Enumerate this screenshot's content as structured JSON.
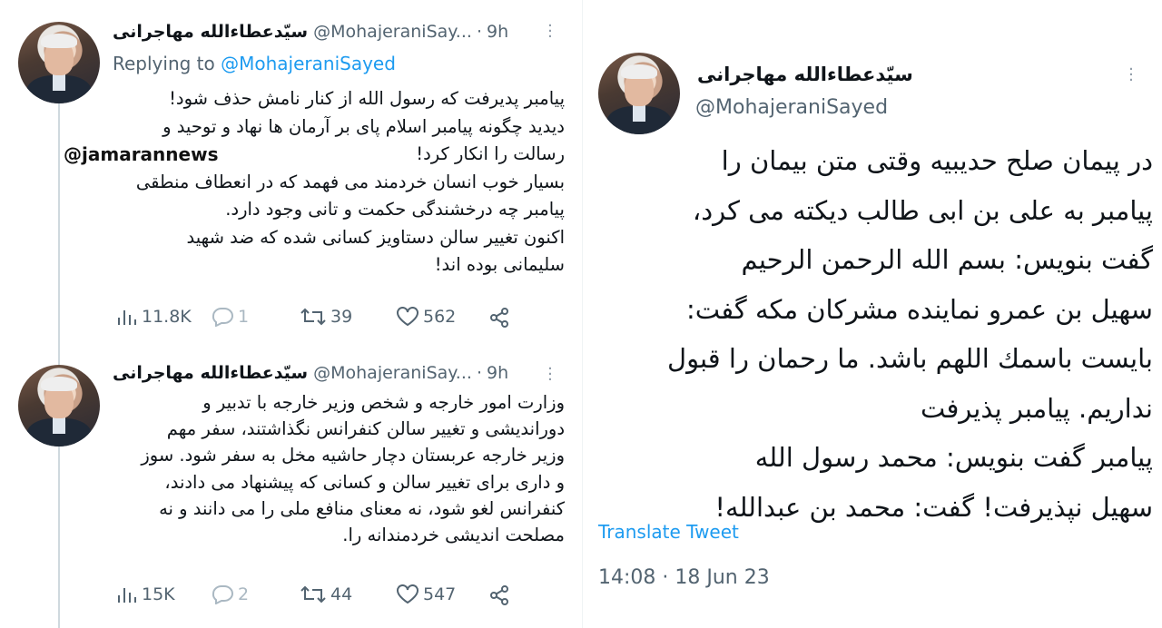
{
  "watermark": "@jamarannews",
  "thread": [
    {
      "display_name": "سیّدعطاءالله مهاجرانی",
      "handle": "@MohajeraniSay...",
      "dot": "·",
      "time": "9h",
      "more_icon": "more-dots-icon",
      "replying_prefix": "Replying to ",
      "replying_to": "@MohajeraniSayed",
      "text": "پیامبر پدیرفت که رسول الله از کنار نامش حذف شود!\nدیدید چگونه پیامبر اسلام پای بر آرمان ها نهاد و توحید و\nرسالت را انکار کرد!\nبسیار خوب انسان خردمند می فهمد که در انعطاف منطقی\nپیامبر چه درخشندگی حکمت و تانی وجود دارد.\nاکنون تغییر سالن دستاویز کسانی شده که ضد شهید\nسلیمانی بوده اند!",
      "stats": {
        "views": "11.8K",
        "replies": "1",
        "retweets": "39",
        "likes": "562"
      }
    },
    {
      "display_name": "سیّدعطاءالله مهاجرانی",
      "handle": "@MohajeraniSay...",
      "dot": "·",
      "time": "9h",
      "more_icon": "more-dots-icon",
      "text": "وزارت امور خارجه و شخص وزیر خارجه با تدبیر و\nدوراندیشی و تغییر سالن کنفرانس نگذاشتند، سفر مهم\nوزیر خارجه عربستان دچار حاشیه مخل به سفر شود. سوز\nو داری برای تغییر سالن و کسانی که پیشنهاد می دادند،\nکنفرانس لغو شود، نه معنای منافع ملی را می دانند و نه\nمصلحت اندیشی خردمندانه را.",
      "stats": {
        "views": "15K",
        "replies": "2",
        "retweets": "44",
        "likes": "547"
      }
    }
  ],
  "main_tweet": {
    "display_name": "سیّدعطاءالله مهاجرانی",
    "handle": "@MohajeraniSayed",
    "more_icon": "more-dots-icon",
    "text": "در پیمان صلح حدیبیه وقتی متن بیمان را\nپیامبر به علی بن ابی طالب دیکته می کرد،\nگفت بنویس: بسم الله الرحمن الرحیم\nسهیل بن عمرو نماینده مشرکان مکه گفت:\nبایست باسمك اللهم باشد. ما رحمان را قبول\nنداریم. پیامبر پذیرفت\nپیامبر گفت بنویس: محمد رسول الله\nسهیل نپذیرفت! گفت: محمد بن عبدالله!",
    "translate_label": "Translate Tweet",
    "timestamp": "14:08 · 18 Jun 23"
  },
  "colors": {
    "accent": "#1d9bf0",
    "secondary_text": "#536471",
    "primary_text": "#0f1419",
    "thread_line": "#cfd9de"
  }
}
